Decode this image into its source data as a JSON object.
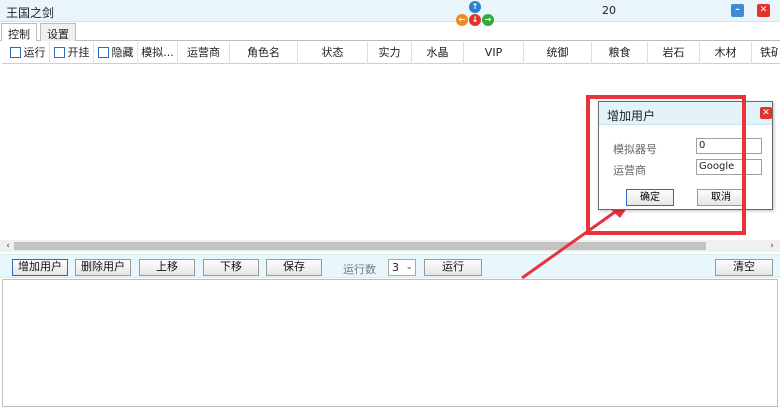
{
  "window": {
    "title": "王国之剑",
    "counter": "20"
  },
  "tabs": [
    {
      "label": "控制"
    },
    {
      "label": "设置"
    }
  ],
  "grid": {
    "columns": [
      {
        "label": "运行",
        "checkbox": true
      },
      {
        "label": "开挂",
        "checkbox": true
      },
      {
        "label": "隐藏",
        "checkbox": true
      },
      {
        "label": "模拟..."
      },
      {
        "label": "运营商"
      },
      {
        "label": "角色名"
      },
      {
        "label": "状态"
      },
      {
        "label": "实力"
      },
      {
        "label": "水晶"
      },
      {
        "label": "VIP"
      },
      {
        "label": "统御"
      },
      {
        "label": "粮食"
      },
      {
        "label": "岩石"
      },
      {
        "label": "木材"
      },
      {
        "label": "铁矿"
      }
    ]
  },
  "toolbar": {
    "add_user": "增加用户",
    "delete_user": "删除用户",
    "move_up": "上移",
    "move_down": "下移",
    "save": "保存",
    "run_count_label": "运行数",
    "run_count_value": "3",
    "run": "运行",
    "clear": "清空"
  },
  "dialog": {
    "title": "增加用户",
    "emulator_label": "模拟器号",
    "emulator_value": "0",
    "carrier_label": "运营商",
    "carrier_value": "Google",
    "confirm": "确定",
    "cancel": "取消"
  },
  "colors": {
    "highlight": "#e8333d",
    "toolbar_bg": "#e7f7fb",
    "titlebar_bg": "#e9f5fb"
  }
}
